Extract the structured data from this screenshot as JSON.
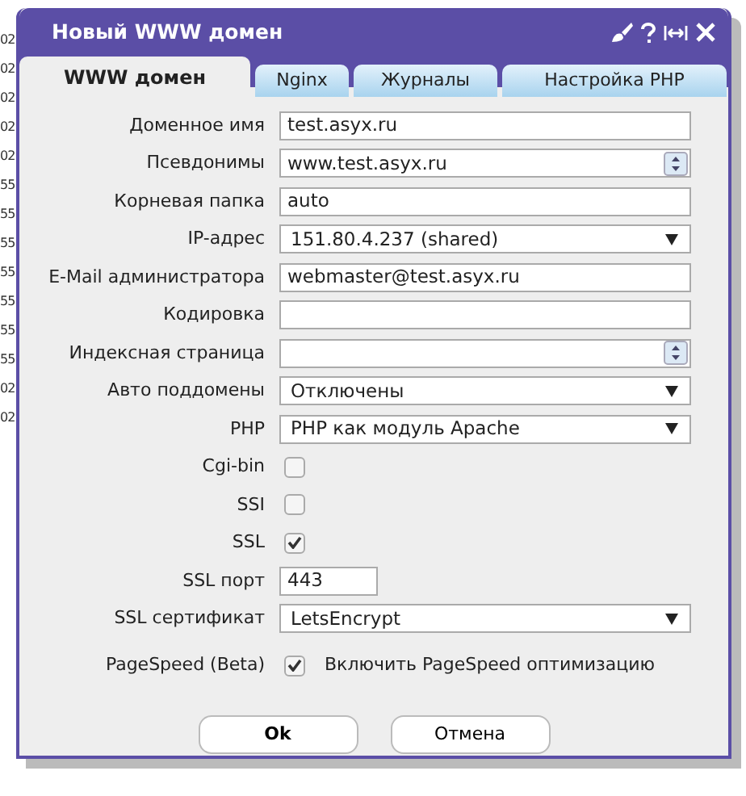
{
  "background_fragments": [
    "02",
    "02",
    "02",
    "02",
    "02",
    "55",
    "55",
    "55",
    "55",
    "55",
    "55",
    "55",
    "02",
    "02"
  ],
  "window": {
    "title": "Новый WWW домен"
  },
  "tabs": [
    {
      "label": "WWW домен",
      "selected": true
    },
    {
      "label": "Nginx",
      "selected": false
    },
    {
      "label": "Журналы",
      "selected": false
    },
    {
      "label": "Настройка PHP",
      "selected": false
    }
  ],
  "fields": [
    {
      "kind": "text",
      "label": "Доменное имя",
      "value": "test.asyx.ru"
    },
    {
      "kind": "list",
      "label": "Псевдонимы",
      "value": "www.test.asyx.ru"
    },
    {
      "kind": "text",
      "label": "Корневая папка",
      "value": "auto"
    },
    {
      "kind": "select",
      "label": "IP-адрес",
      "value": "151.80.4.237 (shared)"
    },
    {
      "kind": "text",
      "label": "E-Mail администратора",
      "value": "webmaster@test.asyx.ru"
    },
    {
      "kind": "text",
      "label": "Кодировка"
    },
    {
      "kind": "list",
      "label": "Индексная страница"
    },
    {
      "kind": "select",
      "label": "Авто поддомены",
      "value": "Отключены"
    },
    {
      "kind": "select",
      "label": "PHP",
      "value": "PHP как модуль Apache"
    },
    {
      "kind": "checkbox",
      "label": "Cgi-bin",
      "checked": false
    },
    {
      "kind": "checkbox",
      "label": "SSI",
      "checked": false
    },
    {
      "kind": "checkbox",
      "label": "SSL",
      "checked": true
    },
    {
      "kind": "port",
      "label": "SSL порт",
      "value": "443"
    },
    {
      "kind": "select",
      "label": "SSL сертификат",
      "value": "LetsEncrypt"
    },
    {
      "kind": "checkbox",
      "label": "PageSpeed (Beta)",
      "checked": true,
      "caption": "Включить PageSpeed оптимизацию"
    }
  ],
  "buttons": [
    {
      "label": "Ok",
      "default": true
    },
    {
      "label": "Отмена",
      "default": false
    }
  ]
}
